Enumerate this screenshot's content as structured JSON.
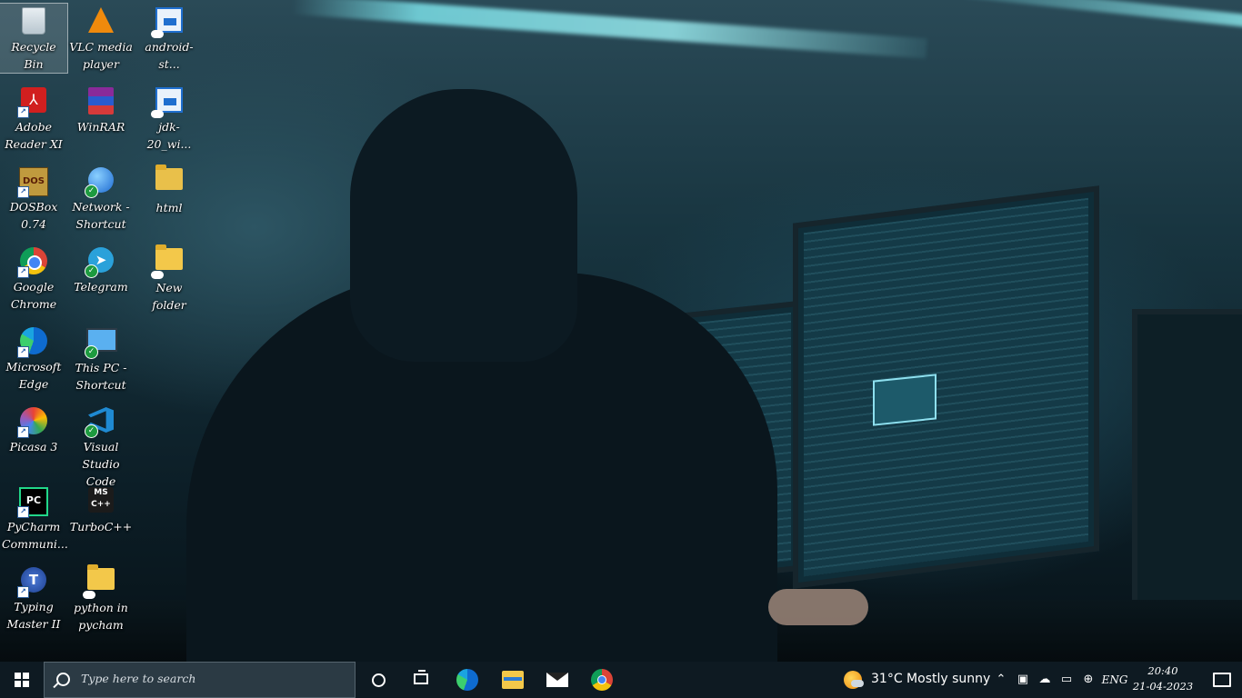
{
  "desktop": {
    "icons": [
      {
        "label": "Recycle Bin"
      },
      {
        "label": "VLC media player"
      },
      {
        "label": "android-st..."
      },
      {
        "label": "Adobe Reader XI"
      },
      {
        "label": "WinRAR"
      },
      {
        "label": "jdk-20_wi..."
      },
      {
        "label": "DOSBox 0.74"
      },
      {
        "label": "Network - Shortcut"
      },
      {
        "label": "html"
      },
      {
        "label": "Google Chrome"
      },
      {
        "label": "Telegram"
      },
      {
        "label": "New folder"
      },
      {
        "label": "Microsoft Edge"
      },
      {
        "label": "This PC - Shortcut"
      },
      {
        "label": "Picasa 3"
      },
      {
        "label": "Visual Studio Code"
      },
      {
        "label": "PyCharm Communi..."
      },
      {
        "label": "TurboC++"
      },
      {
        "label": "Typing Master II"
      },
      {
        "label": "python in pycham"
      }
    ]
  },
  "taskbar": {
    "search_placeholder": "Type here to search",
    "pinned": [
      "Microsoft Edge",
      "File Explorer",
      "Mail",
      "Google Chrome"
    ],
    "weather": {
      "temp": "31°C",
      "condition": "Mostly sunny"
    },
    "language": "ENG",
    "time": "20:40",
    "date": "21-04-2023"
  },
  "colors": {
    "taskbar_bg": "#0e1a22",
    "search_bg": "#2b3a44",
    "accent": "#1d9a3f"
  }
}
